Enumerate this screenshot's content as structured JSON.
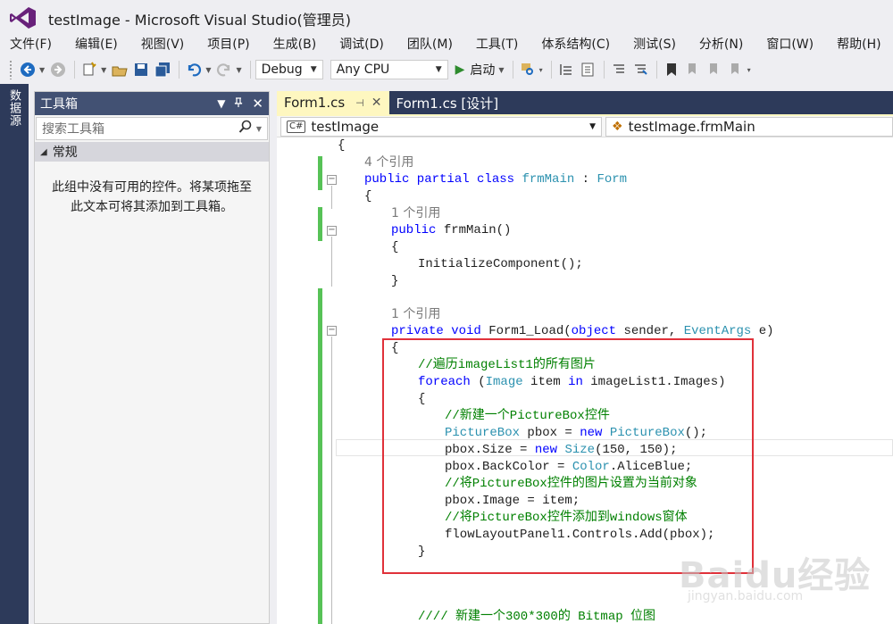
{
  "window": {
    "title": "testImage - Microsoft Visual Studio(管理员)"
  },
  "menu": [
    "文件(F)",
    "编辑(E)",
    "视图(V)",
    "项目(P)",
    "生成(B)",
    "调试(D)",
    "团队(M)",
    "工具(T)",
    "体系结构(C)",
    "测试(S)",
    "分析(N)",
    "窗口(W)",
    "帮助(H)"
  ],
  "toolbar": {
    "config": "Debug",
    "platform": "Any CPU",
    "start_label": "启动"
  },
  "side_tab": "数据源",
  "toolbox": {
    "title": "工具箱",
    "search_placeholder": "搜索工具箱",
    "group": "常规",
    "empty_line1": "此组中没有可用的控件。将某项拖至",
    "empty_line2": "此文本可将其添加到工具箱。"
  },
  "tabs": [
    {
      "label": "Form1.cs",
      "active": true
    },
    {
      "label": "Form1.cs [设计]",
      "active": false
    }
  ],
  "nav": {
    "project": "testImage",
    "member": "testImage.frmMain"
  },
  "code": {
    "l1": "{",
    "l2_ref": "4 个引用",
    "l3_kw": "public partial class",
    "l3_cls": "frmMain",
    "l3_colon": " : ",
    "l3_base": "Form",
    "l4": "{",
    "l5_ref": "1 个引用",
    "l6_kw": "public",
    "l6_rest": " frmMain()",
    "l7": "{",
    "l8": "InitializeComponent();",
    "l9": "}",
    "l10_ref": "1 个引用",
    "l11_kw": "private void",
    "l11_mid": " Form1_Load(",
    "l11_kw2": "object",
    "l11_mid2": " sender, ",
    "l11_ty": "EventArgs",
    "l11_end": " e)",
    "l12": "{",
    "l13": "//遍历imageList1的所有图片",
    "l14_kw": "foreach",
    "l14_a": " (",
    "l14_ty": "Image",
    "l14_b": " item ",
    "l14_kw2": "in",
    "l14_c": " imageList1.Images)",
    "l15": "{",
    "l16": "//新建一个PictureBox控件",
    "l17_ty": "PictureBox",
    "l17_a": " pbox = ",
    "l17_kw": "new",
    "l17_ty2": " PictureBox",
    "l17_b": "();",
    "l18_a": "pbox.Size = ",
    "l18_kw": "new",
    "l18_ty": " Size",
    "l18_b": "(150, 150);",
    "l19_a": "pbox.BackColor = ",
    "l19_ty": "Color",
    "l19_b": ".AliceBlue;",
    "l20": "//将PictureBox控件的图片设置为当前对象",
    "l21": "pbox.Image = item;",
    "l22": "//将PictureBox控件添加到windows窗体",
    "l23": "flowLayoutPanel1.Controls.Add(pbox);",
    "l24": "}",
    "l25": "//// 新建一个300*300的 Bitmap 位图"
  },
  "watermark": {
    "text": "Baidu经验",
    "url": "jingyan.baidu.com"
  },
  "colors": {
    "keyword": "#0000ff",
    "type": "#2b91af",
    "comment": "#008000",
    "highlight": "#e0313a"
  }
}
